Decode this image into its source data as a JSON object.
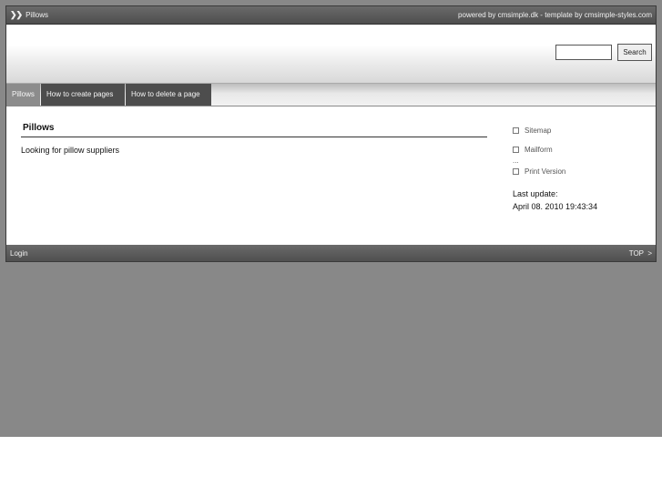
{
  "topbar": {
    "breadcrumb": "Pillows",
    "credits": "powered by cmsimple.dk - template by cmsimple-styles.com"
  },
  "search": {
    "input_value": "",
    "button_label": "Search"
  },
  "nav": {
    "items": [
      {
        "label": "Pillows",
        "active": true
      },
      {
        "label": "How to create pages",
        "active": false
      },
      {
        "label": "How to delete a page",
        "active": false
      }
    ]
  },
  "main": {
    "title": "Pillows",
    "text": "Looking for pillow suppliers"
  },
  "sidebar": {
    "links": [
      "Sitemap",
      "Mailform",
      "Print Version"
    ],
    "separator": "...",
    "last_update_label": "Last update:",
    "last_update_value": "April 08. 2010 19:43:34"
  },
  "footer": {
    "login": "Login",
    "top": "TOP  >"
  },
  "icons": {
    "breadcrumb": "double-chevron-right-icon",
    "sidebar_bullet": "square-bullet-icon"
  },
  "colors": {
    "background": "#888888",
    "bar": "#555555",
    "nav_active": "#8c8c8c",
    "nav_inactive": "#4d4d4d"
  }
}
